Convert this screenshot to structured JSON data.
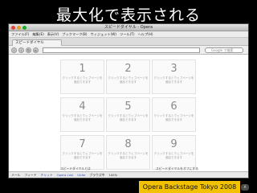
{
  "slide": {
    "title": "最大化で表示される",
    "footer": "Opera Backstage Tokyo 2008",
    "close_glyph": "x"
  },
  "window": {
    "title": "スピードダイヤル - Opera",
    "menus": [
      "ファイル(F)",
      "編集(E)",
      "表示(V)",
      "ブックマーク(B)",
      "ウィジェット(W)",
      "ツール(T)",
      "ヘルプ(H)"
    ],
    "tab_label": "スピードダイヤル",
    "search_placeholder": "Google で検索"
  },
  "speed_dial": {
    "cells": [
      {
        "number": "1",
        "text": "クリックするとウェブページを追加できます"
      },
      {
        "number": "2",
        "text": "クリックするとウェブページを追加できます"
      },
      {
        "number": "3",
        "text": "クリックするとウェブページを追加できます"
      },
      {
        "number": "4",
        "text": "クリックするとウェブページを追加できます"
      },
      {
        "number": "5",
        "text": "クリックするとウェブページを追加できます"
      },
      {
        "number": "6",
        "text": "クリックするとウェブページを追加できます"
      },
      {
        "number": "7",
        "text": "クリックするとウェブページを追加できます"
      },
      {
        "number": "8",
        "text": "クリックするとウェブページを追加できます"
      },
      {
        "number": "9",
        "text": "クリックするとウェブページを追加できます"
      }
    ],
    "link_left": "スピードダイヤルとは",
    "link_right": "スピードダイヤルをオフにする"
  },
  "statusbar": {
    "items": [
      "メール",
      "フィード",
      "チャット",
      "Opera Link",
      "Unite",
      "ブラウズ中",
      "100%"
    ]
  },
  "colors": {
    "footer_bg": "#f2c100",
    "accent": "#2a4fb8"
  }
}
